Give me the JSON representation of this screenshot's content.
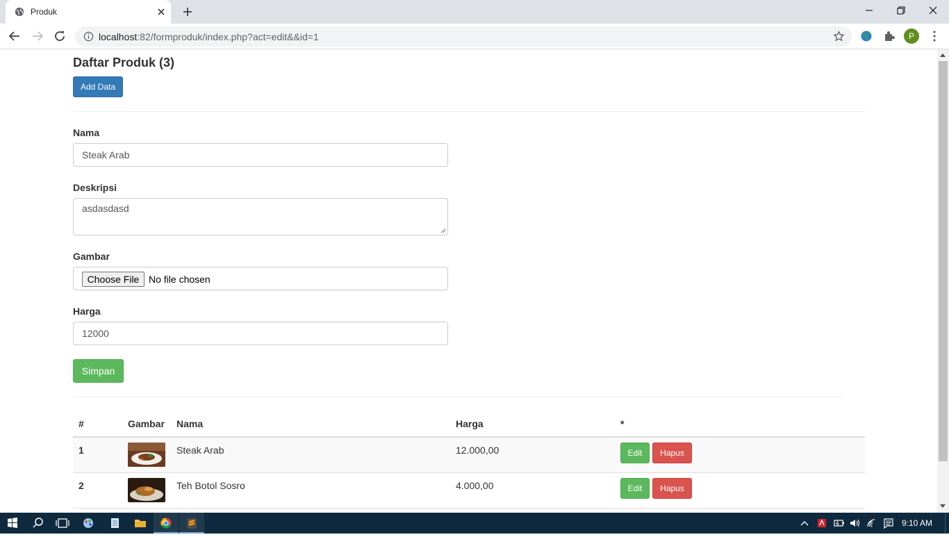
{
  "browser": {
    "tab_title": "Produk",
    "url_host": "localhost",
    "url_path": ":82/formproduk/index.php?act=edit&&id=1",
    "profile_initial": "P"
  },
  "page": {
    "title": "Daftar Produk (3)",
    "add_button": "Add Data"
  },
  "form": {
    "nama_label": "Nama",
    "nama_value": "Steak Arab",
    "deskripsi_label": "Deskripsi",
    "deskripsi_value": "asdasdasd",
    "gambar_label": "Gambar",
    "file_button": "Choose File",
    "file_status": "No file chosen",
    "harga_label": "Harga",
    "harga_value": "12000",
    "save_button": "Simpan"
  },
  "table": {
    "headers": [
      "#",
      "Gambar",
      "Nama",
      "Harga",
      "*"
    ],
    "rows": [
      {
        "no": "1",
        "image": "steak-arab-photo",
        "nama": "Steak Arab",
        "harga": "12.000,00",
        "edit": "Edit",
        "delete": "Hapus"
      },
      {
        "no": "2",
        "image": "teh-botol-sosro-photo",
        "nama": "Teh Botol Sosro",
        "harga": "4.000,00",
        "edit": "Edit",
        "delete": "Hapus"
      }
    ]
  },
  "taskbar": {
    "time": "9:10 AM"
  },
  "colors": {
    "primary": "#337ab7",
    "success": "#5cb85c",
    "danger": "#d9534f",
    "taskbar": "#0f2a3f"
  }
}
